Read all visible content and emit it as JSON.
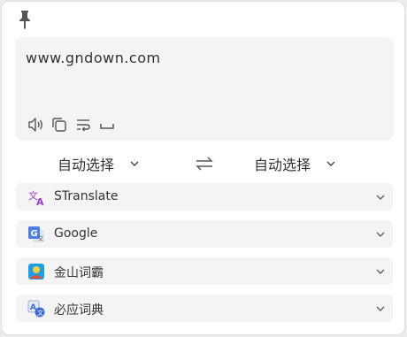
{
  "input": {
    "text": "www.gndown.com"
  },
  "toolbar": {
    "icons": [
      "speaker-icon",
      "copy-icon",
      "wrap-icon",
      "space-icon"
    ]
  },
  "languages": {
    "source": "自动选择",
    "target": "自动选择"
  },
  "services": [
    {
      "name": "STranslate",
      "icon": "stranslate-logo-icon"
    },
    {
      "name": "Google",
      "icon": "google-translate-logo-icon"
    },
    {
      "name": "金山词霸",
      "icon": "kingsoft-logo-icon"
    },
    {
      "name": "必应词典",
      "icon": "bing-dict-logo-icon"
    }
  ],
  "colors": {
    "panel": "#f4f4f4",
    "stranslate": "#9b3fd6",
    "google": "#4a7fe8",
    "kingsoft": "#1aa0e8"
  }
}
